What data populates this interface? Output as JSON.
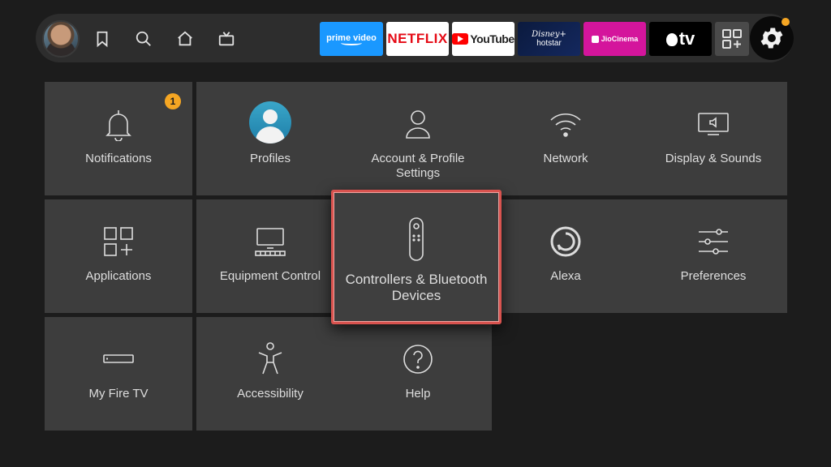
{
  "topbar": {
    "nav_icons": [
      "avatar",
      "bookmark-icon",
      "search-icon",
      "home-icon",
      "live-tv-icon"
    ],
    "apps": [
      {
        "name": "prime-video",
        "label": "prime video",
        "bg": "#1a98ff"
      },
      {
        "name": "netflix",
        "label": "NETFLIX",
        "bg": "#ffffff"
      },
      {
        "name": "youtube",
        "label": "YouTube",
        "bg": "#ffffff"
      },
      {
        "name": "hotstar",
        "label_top": "Disney+",
        "label_bottom": "hotstar",
        "bg": "#0b1a3e"
      },
      {
        "name": "jiocinema",
        "label": "JioCinema",
        "bg": "#d4159c"
      },
      {
        "name": "apple-tv",
        "label": "tv",
        "bg": "#000000"
      }
    ],
    "settings_notification_color": "#f5a623"
  },
  "tiles": [
    {
      "label": "Notifications",
      "icon": "bell-icon",
      "badge": "1"
    },
    {
      "label": "Profiles",
      "icon": "profile-icon"
    },
    {
      "label": "Account & Profile Settings",
      "icon": "person-icon"
    },
    {
      "label": "Network",
      "icon": "wifi-icon"
    },
    {
      "label": "Display & Sounds",
      "icon": "display-sound-icon"
    },
    {
      "label": "Applications",
      "icon": "apps-icon"
    },
    {
      "label": "Equipment Control",
      "icon": "equipment-icon"
    },
    {
      "label": "Controllers & Bluetooth Devices",
      "icon": "remote-icon",
      "focused": true
    },
    {
      "label": "Alexa",
      "icon": "alexa-icon"
    },
    {
      "label": "Preferences",
      "icon": "sliders-icon"
    },
    {
      "label": "My Fire TV",
      "icon": "fire-tv-icon"
    },
    {
      "label": "Accessibility",
      "icon": "accessibility-icon"
    },
    {
      "label": "Help",
      "icon": "help-icon"
    }
  ],
  "colors": {
    "focus_border": "#d9534f",
    "badge": "#f5a623",
    "tile_bg": "#3d3d3d",
    "background": "#1c1c1c"
  }
}
